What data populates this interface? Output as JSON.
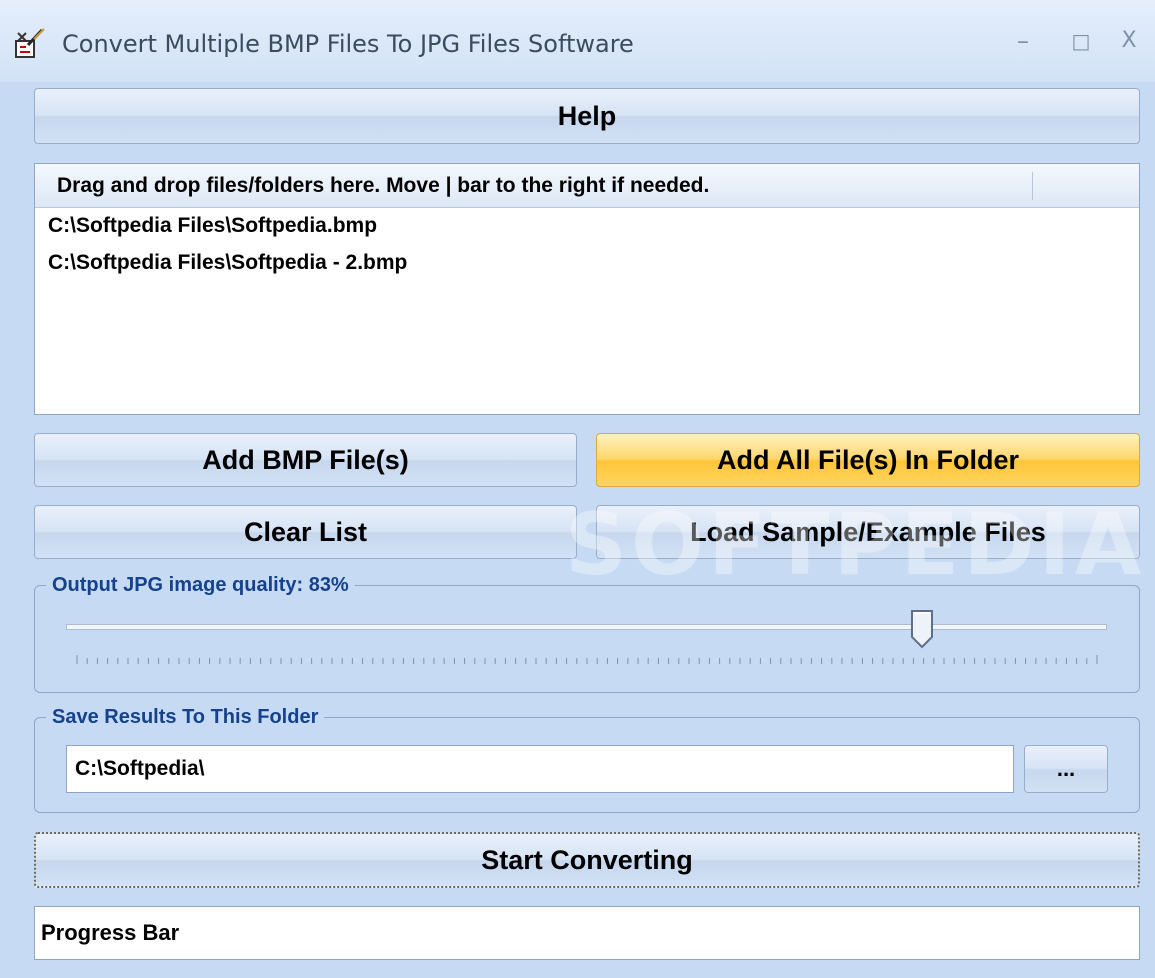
{
  "window": {
    "title": "Convert Multiple BMP Files To JPG Files Software",
    "minimize_glyph": "–",
    "maximize_glyph": "□",
    "close_glyph": "X"
  },
  "toolbar": {
    "help_label": "Help"
  },
  "file_list": {
    "header": "Drag and drop files/folders here. Move | bar to the right if needed.",
    "items": [
      "C:\\Softpedia Files\\Softpedia.bmp",
      "C:\\Softpedia Files\\Softpedia - 2.bmp"
    ]
  },
  "buttons": {
    "add_bmp": "Add BMP File(s)",
    "add_folder": "Add All File(s) In Folder",
    "clear_list": "Clear List",
    "load_sample": "Load Sample/Example Files",
    "browse": "...",
    "start": "Start Converting"
  },
  "quality": {
    "label": "Output JPG image quality: 83%",
    "value_percent": 83
  },
  "output": {
    "label": "Save Results To This Folder",
    "folder": "C:\\Softpedia\\"
  },
  "progress": {
    "text": "Progress Bar"
  },
  "watermark": {
    "text": "SOFTPEDIA"
  },
  "colors": {
    "window_bg": "#c6daf3",
    "group_label": "#15428b",
    "hot_button": "#ffc537"
  },
  "icons": {
    "app": "app-paint-icon",
    "minimize": "minimize-icon",
    "maximize": "maximize-icon",
    "close": "close-icon",
    "slider_thumb": "slider-thumb-icon"
  }
}
